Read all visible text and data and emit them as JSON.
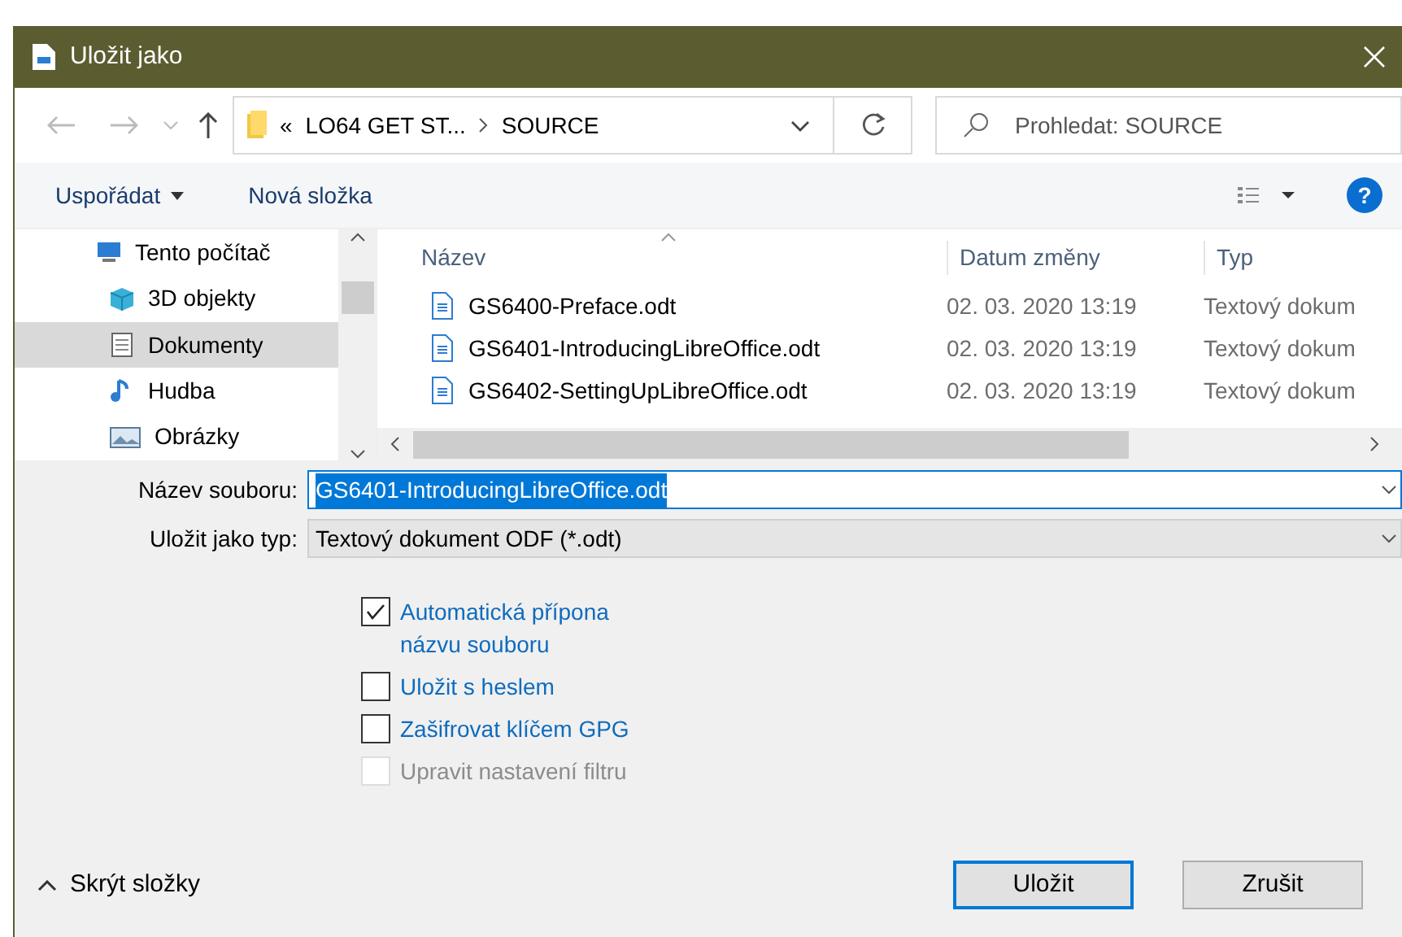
{
  "window": {
    "title": "Uložit jako"
  },
  "address": {
    "prefix": "«",
    "path": [
      "LO64 GET ST...",
      "SOURCE"
    ]
  },
  "search": {
    "placeholder": "Prohledat: SOURCE"
  },
  "toolbar": {
    "organize": "Uspořádat",
    "new_folder": "Nová složka",
    "help": "?"
  },
  "sidebar": {
    "items": [
      {
        "label": "Tento počítač",
        "kind": "computer",
        "selected": false
      },
      {
        "label": "3D objekty",
        "kind": "cube",
        "selected": false
      },
      {
        "label": "Dokumenty",
        "kind": "document",
        "selected": true
      },
      {
        "label": "Hudba",
        "kind": "music",
        "selected": false
      },
      {
        "label": "Obrázky",
        "kind": "picture",
        "selected": false
      }
    ]
  },
  "table": {
    "columns": [
      "Název",
      "Datum změny",
      "Typ"
    ],
    "rows": [
      {
        "name": "GS6400-Preface.odt",
        "date": "02. 03. 2020 13:19",
        "type": "Textový dokum"
      },
      {
        "name": "GS6401-IntroducingLibreOffice.odt",
        "date": "02. 03. 2020 13:19",
        "type": "Textový dokum"
      },
      {
        "name": "GS6402-SettingUpLibreOffice.odt",
        "date": "02. 03. 2020 13:19",
        "type": "Textový dokum"
      }
    ]
  },
  "filename": {
    "label": "Název souboru:",
    "value": "GS6401-IntroducingLibreOffice.odt"
  },
  "filetype": {
    "label": "Uložit jako typ:",
    "value": "Textový dokument ODF (*.odt)"
  },
  "options": [
    {
      "label": "Automatická přípona\nnázvu souboru",
      "checked": true,
      "disabled": false
    },
    {
      "label": "Uložit s heslem",
      "checked": false,
      "disabled": false
    },
    {
      "label": "Zašifrovat klíčem GPG",
      "checked": false,
      "disabled": false
    },
    {
      "label": "Upravit nastavení filtru",
      "checked": false,
      "disabled": true
    }
  ],
  "hide_folders": "Skrýt složky",
  "buttons": [
    {
      "label": "Uložit",
      "default": true
    },
    {
      "label": "Zrušit",
      "default": false
    }
  ]
}
